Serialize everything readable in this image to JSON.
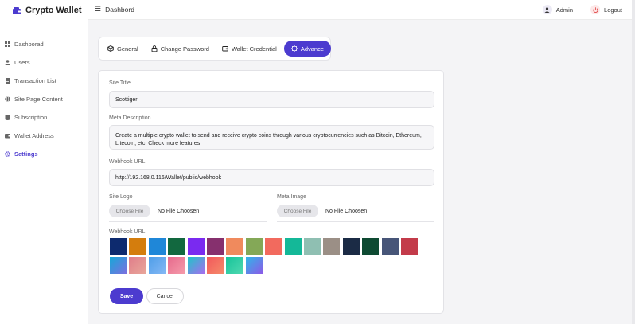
{
  "brand": {
    "name": "Crypto Wallet",
    "color": "#4c3bcf"
  },
  "sidebar": {
    "items": [
      {
        "label": "Dashborad",
        "icon": "grid-icon"
      },
      {
        "label": "Users",
        "icon": "user-icon"
      },
      {
        "label": "Transaction List",
        "icon": "document-icon"
      },
      {
        "label": "Site Page Content",
        "icon": "globe-icon"
      },
      {
        "label": "Subscription",
        "icon": "database-icon"
      },
      {
        "label": "Wallet Address",
        "icon": "wallet-icon"
      },
      {
        "label": "Settings",
        "icon": "settings-icon",
        "active": true
      }
    ]
  },
  "topbar": {
    "title": "Dashbord",
    "user": "Admin",
    "logout": "Logout"
  },
  "tabs": [
    {
      "label": "General",
      "icon": "cube-icon"
    },
    {
      "label": "Change Password",
      "icon": "lock-icon"
    },
    {
      "label": "Wallet Credential",
      "icon": "wallet-icon"
    },
    {
      "label": "Advance",
      "icon": "badge-icon",
      "active": true
    }
  ],
  "form": {
    "site_title": {
      "label": "Site Title",
      "value": "Scottiger"
    },
    "meta_description": {
      "label": "Meta Description",
      "value": "Create a multiple crypto wallet to send and receive crypto coins through various cryptocurrencies such as Bitcoin, Ethereum, Litecoin, etc. Check more features"
    },
    "webhook_url": {
      "label": "Webhook URL",
      "value": "http://192.168.0.116/Wallet/public/webhook"
    },
    "site_logo": {
      "label": "Site Logo",
      "button": "Choose File",
      "status": "No File Choosen"
    },
    "meta_image": {
      "label": "Meta Image",
      "button": "Choose File",
      "status": "No File Choosen"
    },
    "theme": {
      "label": "Webhook URL",
      "swatches": [
        "#0d2a6e",
        "#d47d0d",
        "#1f87d8",
        "#12683f",
        "#7a2af0",
        "#86306e",
        "#f08a5d",
        "#84a857",
        "#f26a5e",
        "#14b898",
        "#8fbfb2",
        "#9b8f86",
        "#1b2b45",
        "#0e4a32",
        "#475578",
        "#c33b4a",
        "linear-gradient(135deg,#16a8d8,#7b6fe0)",
        "linear-gradient(135deg,#e07d8a,#e8a69a)",
        "linear-gradient(135deg,#4f9ee8,#84b8f5)",
        "linear-gradient(135deg,#e66a8c,#f59aaa)",
        "linear-gradient(135deg,#1fc5c8,#a66df0)",
        "linear-gradient(135deg,#f2585b,#f58a6a)",
        "linear-gradient(135deg,#17c39a,#4fd8b0)",
        "linear-gradient(135deg,#2fb6e8,#8c5ae8)"
      ]
    },
    "save": "Save",
    "cancel": "Cancel"
  }
}
